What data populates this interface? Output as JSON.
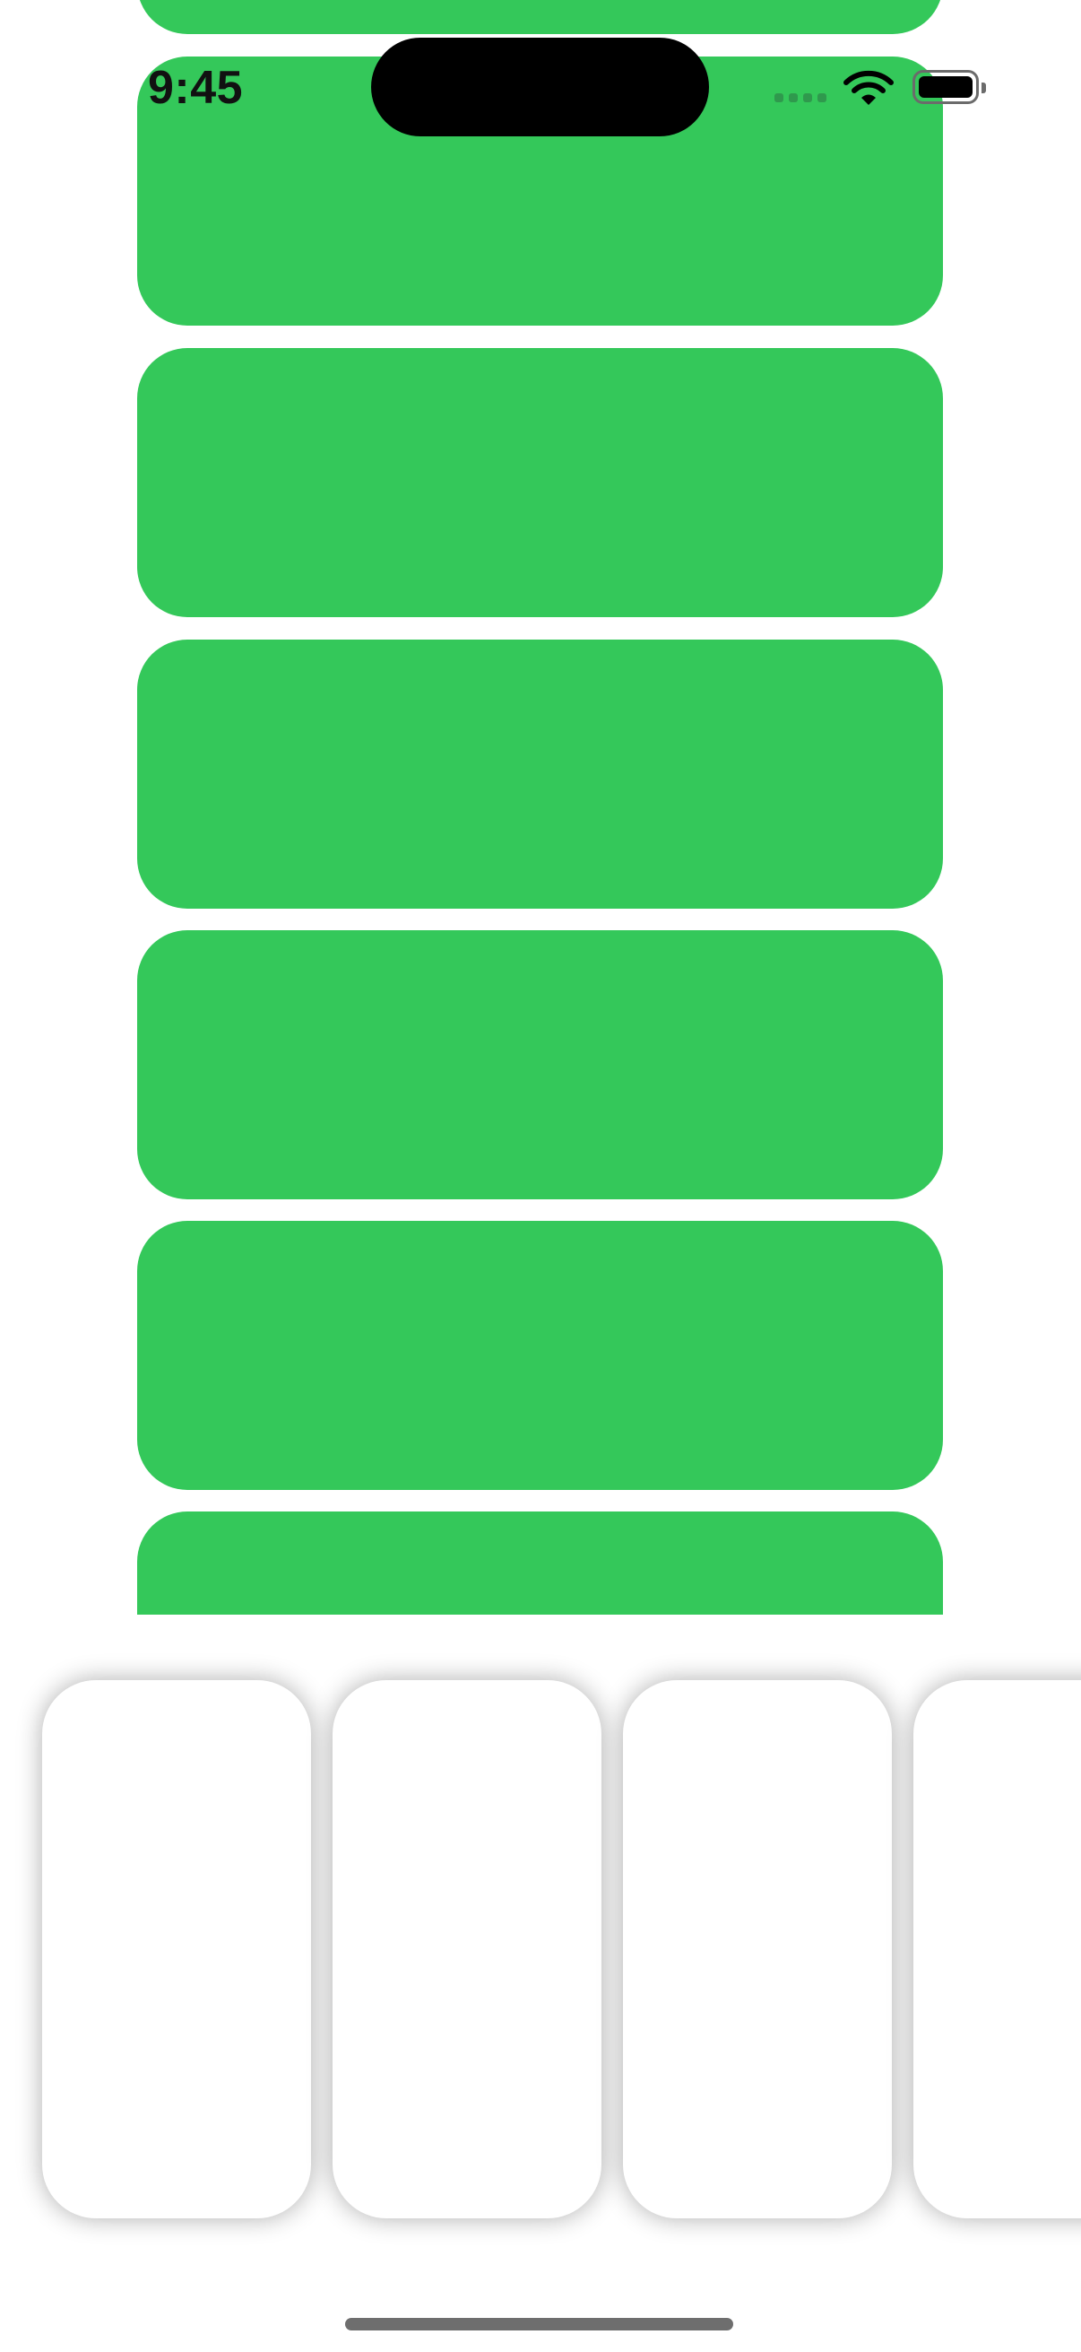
{
  "status_bar": {
    "time": "9:45"
  },
  "colors": {
    "card_green": "#34C85A",
    "home_indicator": "#6e6e6e"
  },
  "vertical_list": {
    "item_count_visible": 7
  },
  "horizontal_list": {
    "item_count_visible": 4
  },
  "icons": [
    "wifi-icon",
    "battery-icon",
    "cellular-signal-icon"
  ]
}
